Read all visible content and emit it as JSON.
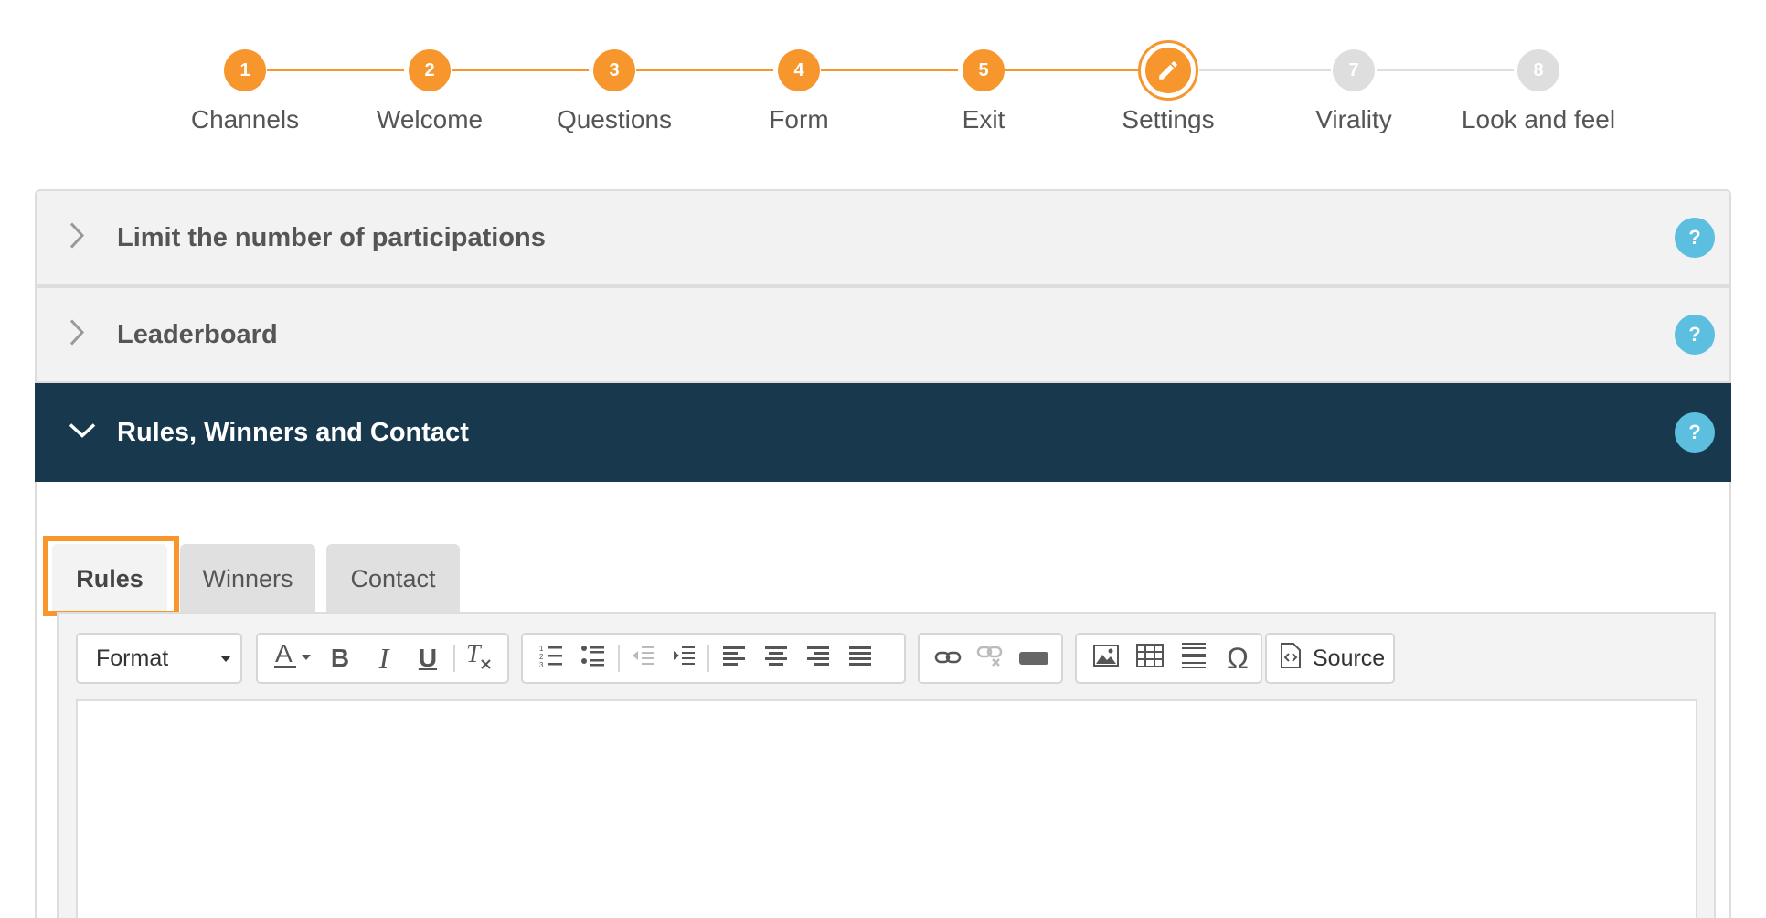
{
  "stepper": {
    "steps": [
      {
        "number": "1",
        "label": "Channels",
        "state": "done"
      },
      {
        "number": "2",
        "label": "Welcome",
        "state": "done"
      },
      {
        "number": "3",
        "label": "Questions",
        "state": "done"
      },
      {
        "number": "4",
        "label": "Form",
        "state": "done"
      },
      {
        "number": "5",
        "label": "Exit",
        "state": "done"
      },
      {
        "number": "",
        "label": "Settings",
        "state": "current",
        "icon": "pencil-icon"
      },
      {
        "number": "7",
        "label": "Virality",
        "state": "todo"
      },
      {
        "number": "8",
        "label": "Look and feel",
        "state": "todo"
      }
    ],
    "colors": {
      "done": "#f7962c",
      "todo": "#dedede"
    }
  },
  "accordion": [
    {
      "title": "Limit the number of participations",
      "expanded": false,
      "help": "?"
    },
    {
      "title": "Leaderboard",
      "expanded": false,
      "help": "?"
    },
    {
      "title": "Rules, Winners and Contact",
      "expanded": true,
      "help": "?"
    }
  ],
  "tabs": [
    {
      "label": "Rules",
      "active": true
    },
    {
      "label": "Winners",
      "active": false
    },
    {
      "label": "Contact",
      "active": false
    }
  ],
  "editor": {
    "format_label": "Format",
    "source_label": "Source",
    "text_icons": {
      "bold": "B",
      "italic": "I",
      "underline": "U",
      "special_char": "Ω"
    },
    "content": ""
  },
  "colors": {
    "accent": "#f7962c",
    "header_dark": "#17384d",
    "help": "#5cbfe0"
  }
}
